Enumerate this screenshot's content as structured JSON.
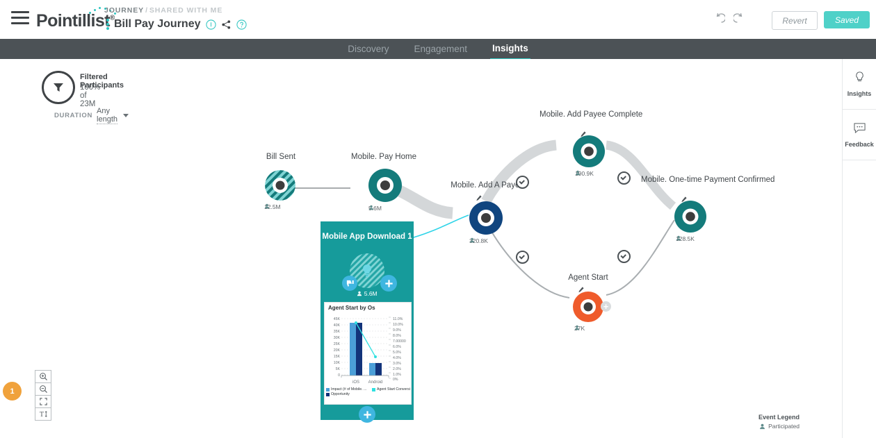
{
  "header": {
    "logo_text": "Pointillist",
    "logo_reg": "®",
    "breadcrumb_primary": "JOURNEY",
    "breadcrumb_sep": "/",
    "breadcrumb_secondary": "SHARED WITH ME",
    "journey_title": "Bill Pay Journey",
    "icons": [
      "info-icon",
      "share-icon",
      "help-icon"
    ],
    "undo_label": "undo-icon",
    "redo_label": "redo-icon",
    "revert_label": "Revert",
    "saved_label": "Saved",
    "accent_color": "#2fc5c0"
  },
  "nav": {
    "tabs": [
      {
        "label": "Discovery",
        "active": false
      },
      {
        "label": "Engagement",
        "active": false
      },
      {
        "label": "Insights",
        "active": true
      }
    ]
  },
  "filter": {
    "icon": "funnel-icon",
    "title": "Filtered Participants",
    "subtitle": "100% of 23M",
    "duration_label": "DURATION",
    "duration_value": "Any length"
  },
  "journey": {
    "nodes": [
      {
        "id": "bill-sent",
        "label": "Bill Sent",
        "count": "12.5M",
        "color": "#147b7b",
        "style": "striped"
      },
      {
        "id": "mobile-pay-home",
        "label": "Mobile. Pay Home",
        "count": "5.6M",
        "color": "#147b7b",
        "style": "solid"
      },
      {
        "id": "mobile-add-a-payee",
        "label": "Mobile. Add A Payee",
        "count": "320.8K",
        "color": "#10457f",
        "style": "solid"
      },
      {
        "id": "mobile-add-payee-complete",
        "label": "Mobile. Add Payee Complete",
        "count": "190.9K",
        "color": "#147b7b",
        "style": "solid"
      },
      {
        "id": "mobile-one-time-payment-confirmed",
        "label": "Mobile. One-time Payment Confirmed",
        "count": "128.5K",
        "color": "#147b7b",
        "style": "solid"
      },
      {
        "id": "agent-start",
        "label": "Agent Start",
        "count": "27K",
        "color": "#ef5b2b",
        "style": "solid"
      }
    ]
  },
  "insight_card": {
    "title": "Mobile App Download 1",
    "badge_icon": "lightbulb-icon",
    "count": "5.6M",
    "thumbs_down_icon": "thumbs-down-icon",
    "plus_icon": "plus-icon",
    "background_color": "#169b9b"
  },
  "chart_data": {
    "type": "bar",
    "title": "Agent Start by Os",
    "categories": [
      "iOS",
      "Android"
    ],
    "series": [
      {
        "name": "Impact (# of Mobile. ...",
        "values": [
          42000,
          10800
        ],
        "color": "#4b9fd8",
        "axis": "left"
      },
      {
        "name": "Opportunity",
        "values": [
          42000,
          10800
        ],
        "color": "#12337a",
        "axis": "left"
      },
      {
        "name": "Agent Start Conversi",
        "values": [
          10.2,
          4.9
        ],
        "color": "#2fe0e0",
        "axis": "right",
        "type": "line"
      }
    ],
    "ylabel": "",
    "ylim": [
      0,
      45000
    ],
    "y_ticks": [
      "0",
      "5K",
      "10K",
      "15K",
      "20K",
      "25K",
      "30K",
      "35K",
      "40K",
      "45K"
    ],
    "y2lim": [
      0,
      11
    ],
    "y2_ticks": [
      "0%",
      "1.0%",
      "2.0%",
      "3.0%",
      "4.0%",
      "5.0%",
      "6.0%",
      "7.00000",
      "8.0%",
      "9.0%",
      "10.0%",
      "11.0%"
    ],
    "legend_position": "bottom",
    "grid": true
  },
  "sidebar": {
    "items": [
      {
        "label": "Insights",
        "icon": "lightbulb-icon"
      },
      {
        "label": "Feedback",
        "icon": "speech-bubble-icon"
      }
    ]
  },
  "zoom_controls": {
    "items": [
      "zoom-in-icon",
      "zoom-out-icon",
      "fit-screen-icon",
      "text-size-icon"
    ]
  },
  "step_badge": {
    "value": "1",
    "color": "#f0a23c"
  },
  "event_legend": {
    "title": "Event Legend",
    "items": [
      {
        "label": "Participated",
        "icon": "participant-icon"
      }
    ]
  }
}
